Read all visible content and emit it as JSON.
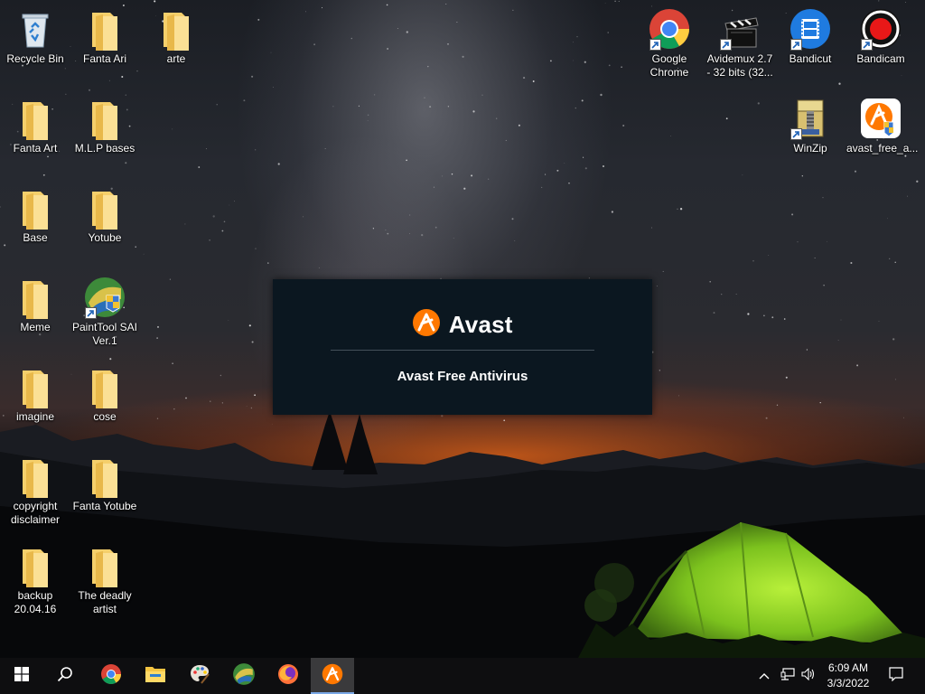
{
  "desktop": {
    "left_icons": [
      {
        "name": "recycle-bin-icon",
        "label": "Recycle Bin"
      },
      {
        "name": "folder-icon",
        "label": "Fanta Ari"
      },
      {
        "name": "folder-icon",
        "label": "arte"
      },
      {
        "name": "folder-icon",
        "label": "Fanta Art"
      },
      {
        "name": "folder-icon",
        "label": "M.L.P bases"
      },
      {
        "name": "folder-icon",
        "label": "Base"
      },
      {
        "name": "folder-icon",
        "label": "Yotube"
      },
      {
        "name": "folder-icon",
        "label": "Meme"
      },
      {
        "name": "painttool-sai-icon",
        "label": "PaintTool SAI Ver.1"
      },
      {
        "name": "folder-icon",
        "label": "imagine"
      },
      {
        "name": "folder-icon",
        "label": "cose"
      },
      {
        "name": "folder-icon",
        "label": "copyright disclaimer"
      },
      {
        "name": "folder-icon",
        "label": "Fanta Yotube"
      },
      {
        "name": "folder-icon",
        "label": "backup 20.04.16"
      },
      {
        "name": "folder-icon",
        "label": "The deadly artist"
      }
    ],
    "right_icons": [
      {
        "name": "google-chrome-icon",
        "label": "Google Chrome"
      },
      {
        "name": "avidemux-icon",
        "label": "Avidemux 2.7 - 32 bits (32..."
      },
      {
        "name": "bandicut-icon",
        "label": "Bandicut"
      },
      {
        "name": "bandicam-icon",
        "label": "Bandicam"
      },
      {
        "name": "winzip-icon",
        "label": "WinZip"
      },
      {
        "name": "avast-installer-icon",
        "label": "avast_free_a..."
      }
    ]
  },
  "splash": {
    "brand": "Avast",
    "product": "Avast Free Antivirus",
    "accent_color": "#ff7800"
  },
  "taskbar": {
    "pinned": [
      {
        "name": "start-button",
        "icon": "windows-logo-icon"
      },
      {
        "name": "search-button",
        "icon": "search-icon"
      },
      {
        "name": "taskbar-chrome",
        "icon": "google-chrome-icon"
      },
      {
        "name": "taskbar-file-explorer",
        "icon": "file-explorer-icon"
      },
      {
        "name": "taskbar-paint",
        "icon": "paint-palette-icon"
      },
      {
        "name": "taskbar-painttool-sai",
        "icon": "painttool-sai-icon"
      },
      {
        "name": "taskbar-firefox",
        "icon": "firefox-icon"
      },
      {
        "name": "taskbar-avast",
        "icon": "avast-icon",
        "active": true
      }
    ],
    "tray_icons": [
      "chevron-up-icon",
      "network-icon",
      "volume-icon"
    ],
    "time": "6:09 AM",
    "date": "3/3/2022",
    "notification_icon": "notification-icon"
  }
}
